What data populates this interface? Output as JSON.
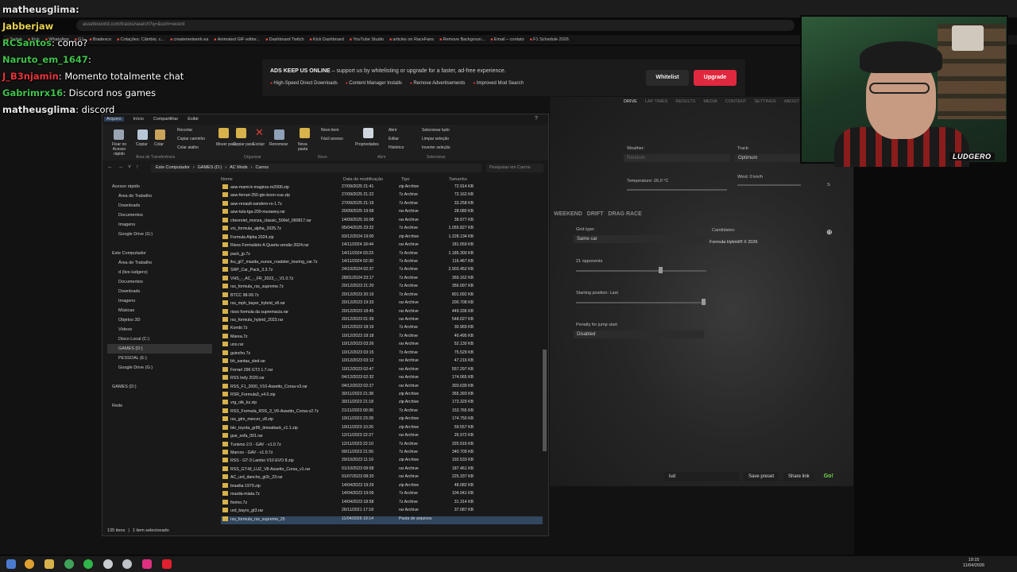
{
  "browser": {
    "url": "assettoworld.com/tracks/search?q=&sort=recent",
    "bookmarks": [
      "Twitch",
      "Kick",
      "WhatsApp",
      "G1",
      "Bradesco",
      "Cotações: Câmbio, c...",
      "createmetwork.ea",
      "Animated GIF editor...",
      "Dashboard Twitch",
      "Kick Dashboard",
      "YouTube Studio",
      "articles on RaceFans",
      "Remove Backgroun...",
      "Email – contato",
      "F1 Schedule 2026"
    ]
  },
  "ad": {
    "title_strong": "ADS KEEP US ONLINE",
    "title_rest": " – support us by whitelisting or upgrade for a faster, ad-free experience.",
    "features": [
      "High-Speed Direct Downloads",
      "Content Manager Installs",
      "Remove Advertisements",
      "Improved Mod Search"
    ],
    "whitelist": "Whitelist",
    "upgrade": "Upgrade"
  },
  "game": {
    "nav": [
      "DRIVE",
      "LAP TIMES",
      "RESULTS",
      "MEDIA",
      "CONTENT",
      "SETTINGS",
      "ABOUT"
    ],
    "weather_label": "Weather:",
    "weather_value": "Random",
    "track_label": "Track:",
    "track_value": "Optimum",
    "temperature": "Temperature: 26.0 °C",
    "wind": "Wind: 0 km/h",
    "wind_dir": "S",
    "mode_tabs": [
      "WEEKEND",
      "DRIFT",
      "DRAG RACE"
    ],
    "grid_type_label": "Grid type:",
    "grid_type_value": "Same car",
    "candidates_label": "Candidates:",
    "candidate": "Formula Hybrid® X 2026",
    "opponents": "21 opponents",
    "starting_position": "Starting position: Last",
    "penalty_label": "Penalty for jump start",
    "penalty_value": "Disabled",
    "preset": "lud",
    "save_preset": "Save preset",
    "share_link": "Share link",
    "go": "Go!"
  },
  "chat": [
    {
      "user": "matheusglima:",
      "color": "#e8e8e8",
      "text": ""
    },
    {
      "user": "Jabberjaw",
      "color": "#e8d050",
      "text": ""
    },
    {
      "user": "RCSantos",
      "color": "#3fc24a",
      "text": ": como?"
    },
    {
      "user": "Naruto_em_1647",
      "color": "#3fc24a",
      "text": ":"
    },
    {
      "user": "J_B3njamin",
      "color": "#e8343a",
      "text": ": Momento totalmente chat"
    },
    {
      "user": "Gabrimrx16",
      "color": "#3fc24a",
      "text": ": Discord nos games"
    },
    {
      "user": "matheusglima",
      "color": "#e8e8e8",
      "text": ": discord"
    }
  ],
  "webcam": {
    "logo": "LUDGERO"
  },
  "explorer": {
    "tabs": [
      "Arquivo",
      "Início",
      "Compartilhar",
      "Exibir"
    ],
    "ribbon": {
      "pin": "Fixar no Acesso rápido",
      "copy": "Copiar",
      "paste": "Colar",
      "cut": "Recortar",
      "copy_path": "Copiar caminho",
      "paste_shortcut": "Colar atalho",
      "move": "Mover para",
      "copy_to": "Copiar para",
      "delete": "Excluir",
      "rename": "Renomear",
      "new_folder": "Nova pasta",
      "new_item": "Novo item",
      "easy_access": "Fácil acesso",
      "properties": "Propriedades",
      "open": "Abrir",
      "edit": "Editar",
      "history": "Histórico",
      "select_all": "Selecionar tudo",
      "select_none": "Limpar seleção",
      "invert": "Inverter seleção",
      "groups": [
        "Área de Transferência",
        "Organizar",
        "Novo",
        "Abrir",
        "Selecionar"
      ]
    },
    "path": [
      "Este Computador",
      "GAMES (D:)",
      "AC Mods",
      "Carros"
    ],
    "search_placeholder": "Pesquisar em Carros",
    "tree": [
      "Acesso rápido",
      "Área de Trabalho",
      "Downloads",
      "Documentos",
      "Imagens",
      "Google Drive (G:)",
      "",
      "Este Computador",
      "Área de Trabalho",
      "d (live-ludgero)",
      "Documentos",
      "Downloads",
      "Imagens",
      "Músicas",
      "Objetos 3D",
      "Vídeos",
      "Disco Local (C:)",
      "GAMES (D:)",
      "PESSOAL (E:)",
      "Google Drive (G:)",
      "",
      "GAMES (D:)",
      "",
      "Rede"
    ],
    "columns": [
      "Nome",
      "Data de modificação",
      "Tipo",
      "Tamanho"
    ],
    "files": [
      [
        "asw-mami-k-magirus-m2000.zip",
        "27/09/2025 21:41",
        "zip Archive",
        "72.914 KB"
      ],
      [
        "asw-ferrari-250-gto-koon-cue.zip",
        "27/09/2025 21:22",
        "7z Archive",
        "72.162 KB"
      ],
      [
        "asw-renault-sandero-rs-1.7z",
        "27/09/2025 21:19",
        "7z Archive",
        "33.258 KB"
      ],
      [
        "asw-tula-tga-200-murawey.rar",
        "20/09/2025 19:58",
        "rar Archive",
        "28.080 KB"
      ],
      [
        "chevrolet_monza_classic_500ef_060817.rar",
        "14/09/2025 16:08",
        "rar Archive",
        "39.977 KB"
      ],
      [
        "vrc_formula_alpha_2025.7z",
        "05/04/2025 23:32",
        "7z Archive",
        "1.055.827 KB"
      ],
      [
        "Formula Alpha 2024.zip",
        "03/12/2024 19:00",
        "zip Archive",
        "1.228.134 KB"
      ],
      [
        "Risos Formulário A Quarta versão 2024.rar",
        "14/11/2024 18:44",
        "rar Archive",
        "181.659 KB"
      ],
      [
        "pack_jp.7z",
        "14/11/2024 03:23",
        "7z Archive",
        "1.185.300 KB"
      ],
      [
        "iku_gt7_mazda_eunos_roadster_touring_car.7z",
        "14/11/2024 02:30",
        "7z Archive",
        "116.467 KB"
      ],
      [
        "SRP_Car_Pack_3.3.7z",
        "24/10/2024 02:37",
        "7z Archive",
        "2.903.452 KB"
      ],
      [
        "VHS_-_AC_-_FR_2023_-_V1.0.7z",
        "28/01/2024 23:17",
        "7z Archive",
        "369.162 KB"
      ],
      [
        "rss_formula_rss_supreme.7z",
        "20/12/2023 21:20",
        "7z Archive",
        "356.097 KB"
      ],
      [
        "BTCC 98-99.7z",
        "20/12/2023 20:19",
        "7z Archive",
        "801.092 KB"
      ],
      [
        "rss_mph_bayer_hybrid_v8.rar",
        "20/12/2023 19:33",
        "rar Archive",
        "200.708 KB"
      ],
      [
        "risos formula da supremacia.rar",
        "20/12/2023 18:45",
        "rar Archive",
        "449.336 KB"
      ],
      [
        "rss_formula_hybrid_2023.rar",
        "20/12/2023 01:39",
        "rar Archive",
        "548.027 KB"
      ],
      [
        "Kombi.7z",
        "10/12/2023 18:19",
        "7z Archive",
        "30.969 KB"
      ],
      [
        "Marea.7z",
        "10/12/2023 18:18",
        "7z Archive",
        "40.495 KB"
      ],
      [
        "uno.rar",
        "10/12/2023 03:26",
        "rar Archive",
        "52.130 KB"
      ],
      [
        "guincho.7z",
        "10/12/2023 03:15",
        "7z Archive",
        "75.529 KB"
      ],
      [
        "bh_santas_sled.rar",
        "10/12/2023 03:12",
        "rar Archive",
        "47.216 KB"
      ],
      [
        "Ferrari 296 GT3 1.7.rar",
        "10/12/2023 02:47",
        "rar Archive",
        "557.297 KB"
      ],
      [
        "RSS Indy 2020.rar",
        "04/12/2023 02:32",
        "rar Archive",
        "174.065 KB"
      ],
      [
        "RSS_F1_2000_V10-Assetto_Corsa-v3.rar",
        "04/12/2023 02:27",
        "rar Archive",
        "303.639 KB"
      ],
      [
        "RSR_Formula3_v4.0.zip",
        "30/11/2023 21:38",
        "zip Archive",
        "365.393 KB"
      ],
      [
        "vrg_otk_kz.zip",
        "30/11/2023 21:18",
        "zip Archive",
        "173.329 KB"
      ],
      [
        "RSS_Formula_RSS_3_V6-Assetto_Corsa-v2.7z",
        "21/11/2023 00:36",
        "7z Archive",
        "153.765 KB"
      ],
      [
        "rss_gtm_mercer_v8.zip",
        "19/11/2023 23:28",
        "zip Archive",
        "174.750 KB"
      ],
      [
        "bkr_toyota_gr86_timeattack_v1.1.zip",
        "19/11/2023 10:26",
        "zip Archive",
        "59.557 KB"
      ],
      [
        "gue_sofa_001.rar",
        "12/11/2023 22:27",
        "rar Archive",
        "26.972 KB"
      ],
      [
        "Turismo 2.0 - GAV - v1.0.7z",
        "12/11/2023 22:10",
        "7z Archive",
        "320.916 KB"
      ],
      [
        "Marcos - GAV - v1.0.7z",
        "09/11/2023 21:56",
        "7z Archive",
        "340.709 KB"
      ],
      [
        "RSS - GT-3 Lambo V10 EVO 8.zip",
        "29/10/2023 11:16",
        "zip Archive",
        "192.533 KB"
      ],
      [
        "RSS_GT-M_LUZ_V8-Assetto_Corsa_v1.rar",
        "01/10/2023 09:58",
        "rar Archive",
        "187.461 KB"
      ],
      [
        "AC_urd_dancho_gt3r_23.rar",
        "01/07/2023 08:20",
        "rar Archive",
        "225.337 KB"
      ],
      [
        "brasilia-1979.zip",
        "14/04/2023 19:29",
        "zip Archive",
        "48.082 KB"
      ],
      [
        "mazda-miata.7z",
        "14/04/2023 19:09",
        "7z Archive",
        "104.941 KB"
      ],
      [
        "fiorino.7z",
        "14/04/2023 18:58",
        "7z Archive",
        "31.314 KB"
      ],
      [
        "urd_bayro_gt3.rar",
        "26/11/2021 17:18",
        "rar Archive",
        "37.087 KB"
      ],
      [
        "rss_formula_rss_supreme_25",
        "11/04/2026 19:14",
        "Pasta de arquivos",
        ""
      ]
    ],
    "status_items": "135 itens",
    "status_selected": "1 item selecionado"
  },
  "taskbar": {
    "time": "19:15",
    "date": "11/04/2026"
  }
}
